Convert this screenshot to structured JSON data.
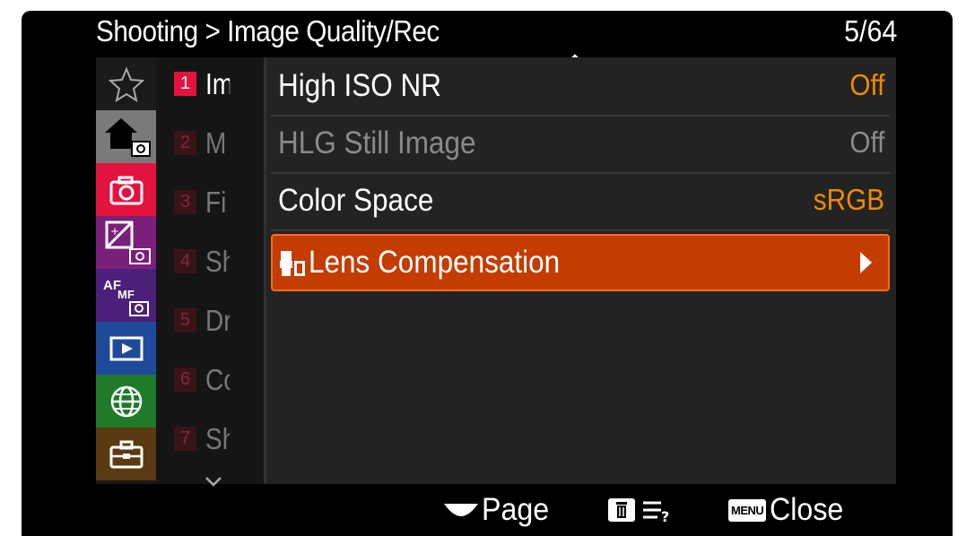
{
  "header": {
    "breadcrumb": "Shooting > Image Quality/Rec",
    "page_indicator": "5/64"
  },
  "categories": [
    {
      "icon": "star-icon",
      "color": "#1a1a1a"
    },
    {
      "icon": "home-camera-icon",
      "color": "#7a7a7a"
    },
    {
      "icon": "camera-icon",
      "color": "#e4123f"
    },
    {
      "icon": "exposure-camera-icon",
      "color": "#7a1f7a"
    },
    {
      "icon": "af-mf-camera-icon",
      "color": "#4b1f7a"
    },
    {
      "icon": "playback-icon",
      "color": "#1f4a9a"
    },
    {
      "icon": "globe-icon",
      "color": "#1f7a2a"
    },
    {
      "icon": "toolbox-icon",
      "color": "#5a3a10"
    }
  ],
  "submenu": [
    {
      "num": "1",
      "label": "Im"
    },
    {
      "num": "2",
      "label": "M"
    },
    {
      "num": "3",
      "label": "Fi"
    },
    {
      "num": "4",
      "label": "Sh"
    },
    {
      "num": "5",
      "label": "Dr"
    },
    {
      "num": "6",
      "label": "Co"
    },
    {
      "num": "7",
      "label": "Sh"
    }
  ],
  "settings": [
    {
      "label": "High ISO NR",
      "value": "Off"
    },
    {
      "label": "HLG Still Image",
      "value": "Off"
    },
    {
      "label": "Color Space",
      "value": "sRGB"
    },
    {
      "label": "Lens Compensation",
      "value": ""
    }
  ],
  "footer": {
    "page_label": "Page",
    "close_badge": "MENU",
    "close_label": "Close"
  },
  "colors": {
    "accent_value": "#f08a00",
    "selected_row": "#c43c00",
    "active_tab": "#e4123f"
  }
}
